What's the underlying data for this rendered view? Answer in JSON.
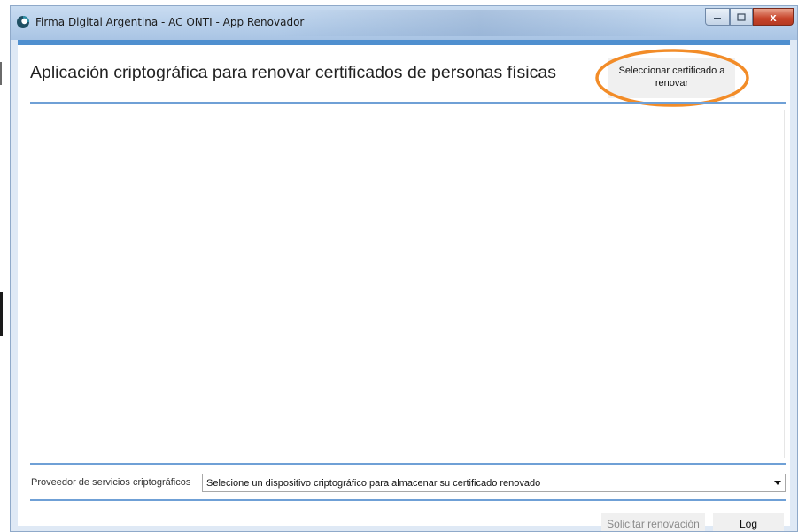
{
  "window": {
    "title": "Firma Digital Argentina - AC ONTI - App Renovador",
    "close_glyph": "x",
    "app_icon": "app-logo-icon",
    "colors": {
      "accent": "#4f8fcf",
      "highlight": "#f28c28",
      "close": "#c7432a"
    }
  },
  "header": {
    "title": "Aplicación criptográfica para renovar certificados de personas físicas",
    "select_cert_label": "Seleccionar certificado a\nrenovar"
  },
  "footer": {
    "provider_label": "Proveedor de servicios criptográficos",
    "provider_select_value": "Selecione un dispositivo criptográfico para almacenar su certificado renovado",
    "renew_button": "Solicitar renovación",
    "log_button": "Log"
  }
}
